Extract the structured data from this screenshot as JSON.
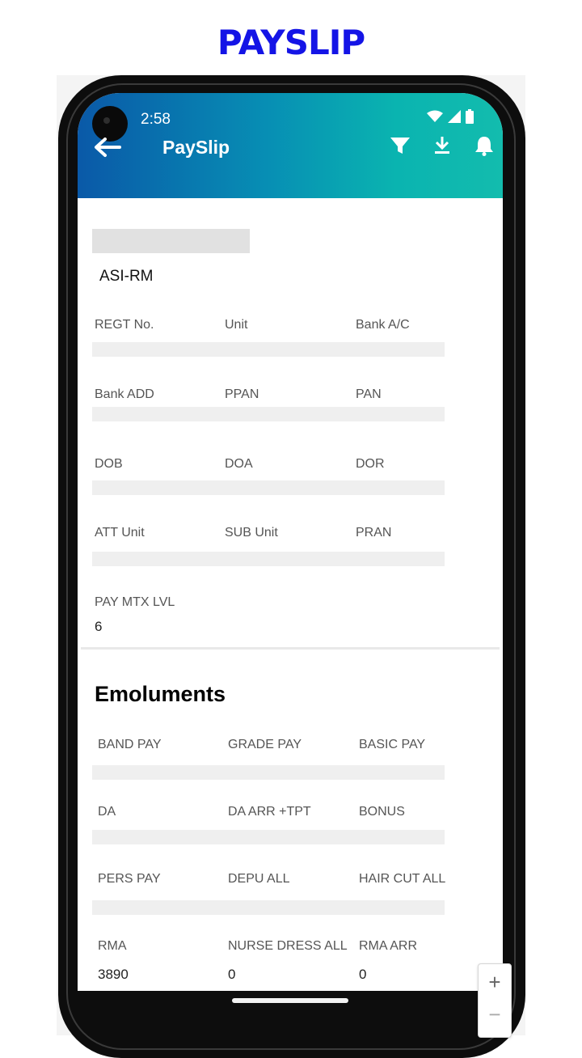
{
  "banner": {
    "title": "PAYSLIP"
  },
  "status_bar": {
    "time": "2:58"
  },
  "appbar": {
    "title": "PaySlip",
    "icons": [
      "back-arrow-icon",
      "filter-icon",
      "download-icon",
      "bell-icon"
    ]
  },
  "employee": {
    "designation": "ASI-RM"
  },
  "details": {
    "row1": {
      "c1": "REGT No.",
      "c2": "Unit",
      "c3": "Bank A/C"
    },
    "row2": {
      "c1": "Bank ADD",
      "c2": "PPAN",
      "c3": "PAN"
    },
    "row3": {
      "c1": "DOB",
      "c2": "DOA",
      "c3": "DOR"
    },
    "row4": {
      "c1": "ATT Unit",
      "c2": "SUB Unit",
      "c3": "PRAN"
    },
    "row5": {
      "c1": "PAY MTX LVL",
      "v1": "6"
    }
  },
  "emoluments": {
    "title": "Emoluments",
    "row1": {
      "c1": "BAND PAY",
      "c2": "GRADE PAY",
      "c3": "BASIC PAY"
    },
    "row2": {
      "c1": "DA",
      "c2": "DA ARR +TPT",
      "c3": "BONUS"
    },
    "row3": {
      "c1": "PERS PAY",
      "c2": "DEPU ALL",
      "c3": "HAIR CUT ALL"
    },
    "row4": {
      "c1": "RMA",
      "c2": "NURSE DRESS ALL",
      "c3": "RMA ARR",
      "v1": "3890",
      "v2": "0",
      "v3": "0"
    }
  },
  "zoom": {
    "plus": "+",
    "minus": "−"
  },
  "colors": {
    "banner": "#1414e6",
    "appbar_start": "#0a59a8",
    "appbar_end": "#13bcae"
  }
}
